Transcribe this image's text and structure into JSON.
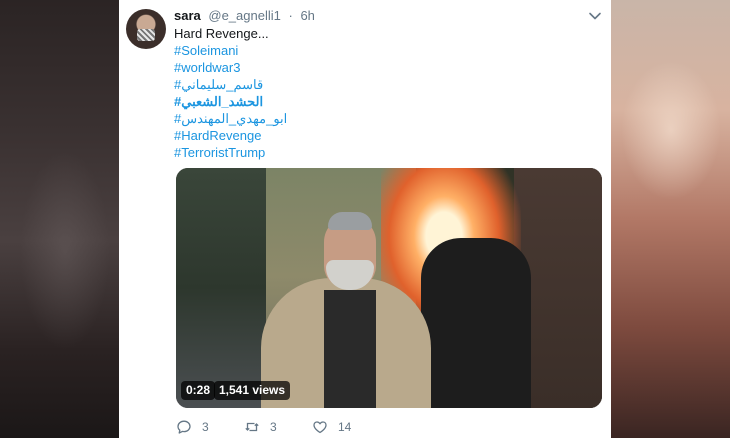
{
  "tweet": {
    "display_name": "sara",
    "handle": "@e_agnelli1",
    "separator": "·",
    "time": "6h",
    "lines": [
      "Hard Revenge...",
      "#Soleimani",
      "#worldwar3",
      "#قاسم_سليماني",
      "#الحشد_الشعبي",
      "#ابو_مهدي_المهندس",
      "#HardRevenge",
      "#TerroristTrump"
    ]
  },
  "media": {
    "duration": "0:28",
    "views": "1,541 views"
  },
  "actions": {
    "replies": "3",
    "retweets": "3",
    "likes": "14"
  },
  "colors": {
    "link": "#1b95e0",
    "text": "#14171a",
    "muted": "#657786"
  },
  "icons": [
    "avatar",
    "chevron-down-icon",
    "reply-icon",
    "retweet-icon",
    "like-icon"
  ]
}
